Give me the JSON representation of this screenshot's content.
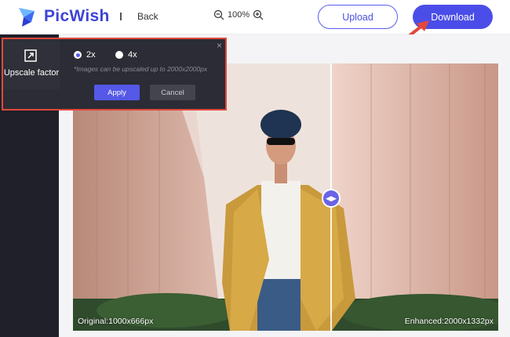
{
  "header": {
    "brand": "PicWish",
    "separator": "I",
    "back_label": "Back",
    "zoom_value": "100%",
    "upload_label": "Upload",
    "download_label": "Download"
  },
  "upscale_panel": {
    "label": "Upscale factor",
    "options": [
      {
        "label": "2x",
        "selected": true
      },
      {
        "label": "4x",
        "selected": false
      }
    ],
    "note": "*Images can be upscaled up to 2000x2000px",
    "apply_label": "Apply",
    "cancel_label": "Cancel"
  },
  "preview": {
    "original_label": "Original:1000x666px",
    "enhanced_label": "Enhanced:2000x1332px"
  },
  "colors": {
    "brand": "#3d44d6",
    "accent": "#4b4de8",
    "highlight_border": "#e2483b",
    "panel_bg": "#2b2c35",
    "sidebar_bg": "#1f2029"
  }
}
